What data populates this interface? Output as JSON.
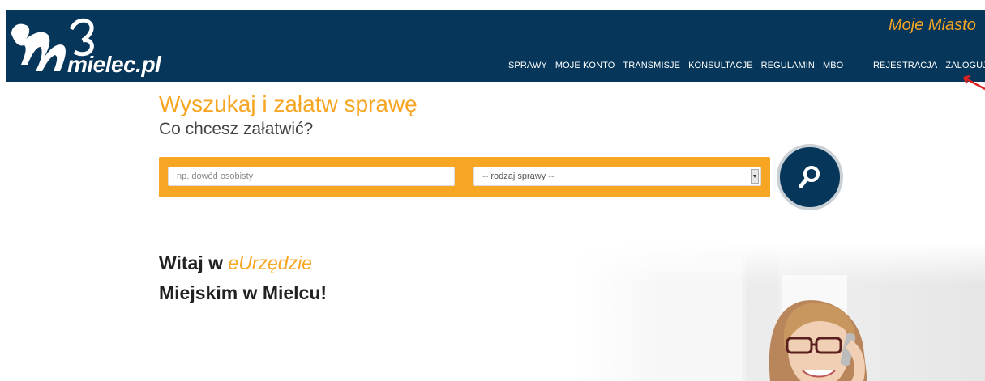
{
  "header": {
    "logo_text": "mielec.pl",
    "city_title": "Moje Miasto",
    "nav": [
      {
        "label": "SPRAWY"
      },
      {
        "label": "MOJE KONTO"
      },
      {
        "label": "TRANSMISJE"
      },
      {
        "label": "KONSULTACJE"
      },
      {
        "label": "REGULAMIN"
      },
      {
        "label": "MBO"
      }
    ],
    "nav_right": [
      {
        "label": "REJESTRACJA"
      },
      {
        "label": "ZALOGUJ"
      }
    ]
  },
  "search": {
    "title": "Wyszukaj i załatw sprawę",
    "subtitle": "Co chcesz załatwić?",
    "input_placeholder": "np. dowód osobisty",
    "select_value": "-- rodzaj sprawy --",
    "button_icon": "search-icon"
  },
  "welcome": {
    "line1_prefix": "Witaj w ",
    "line1_accent": "eUrzędzie",
    "line2": "Miejskim w Mielcu!"
  },
  "colors": {
    "header_bg": "#06365a",
    "accent": "#f7a623",
    "annotation_arrow": "#e02020"
  }
}
